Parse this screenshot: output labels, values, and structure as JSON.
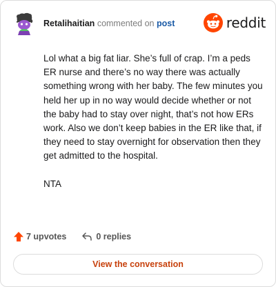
{
  "header": {
    "username": "Retalihaitian",
    "action_text": "commented on",
    "target_link": "post",
    "brand_name": "reddit",
    "brand_color": "#ff4500"
  },
  "comment": {
    "paragraphs": [
      "Lol what a big fat liar. She’s full of crap. I’m a peds ER nurse and there’s no way there was actually something wrong with her baby. The few minutes you held her up in no way would decide whether or not the baby had to stay over night, that’s not how ERs work. Also we don’t keep babies in the ER like that, if they need to stay overnight for observation then they get admitted to the hospital.",
      "NTA"
    ]
  },
  "actions": {
    "upvotes": "7 upvotes",
    "replies": "0 replies",
    "upvote_icon": "arrow-up-icon",
    "reply_icon": "reply-arrow-icon"
  },
  "footer": {
    "view_button": "View the conversation"
  }
}
